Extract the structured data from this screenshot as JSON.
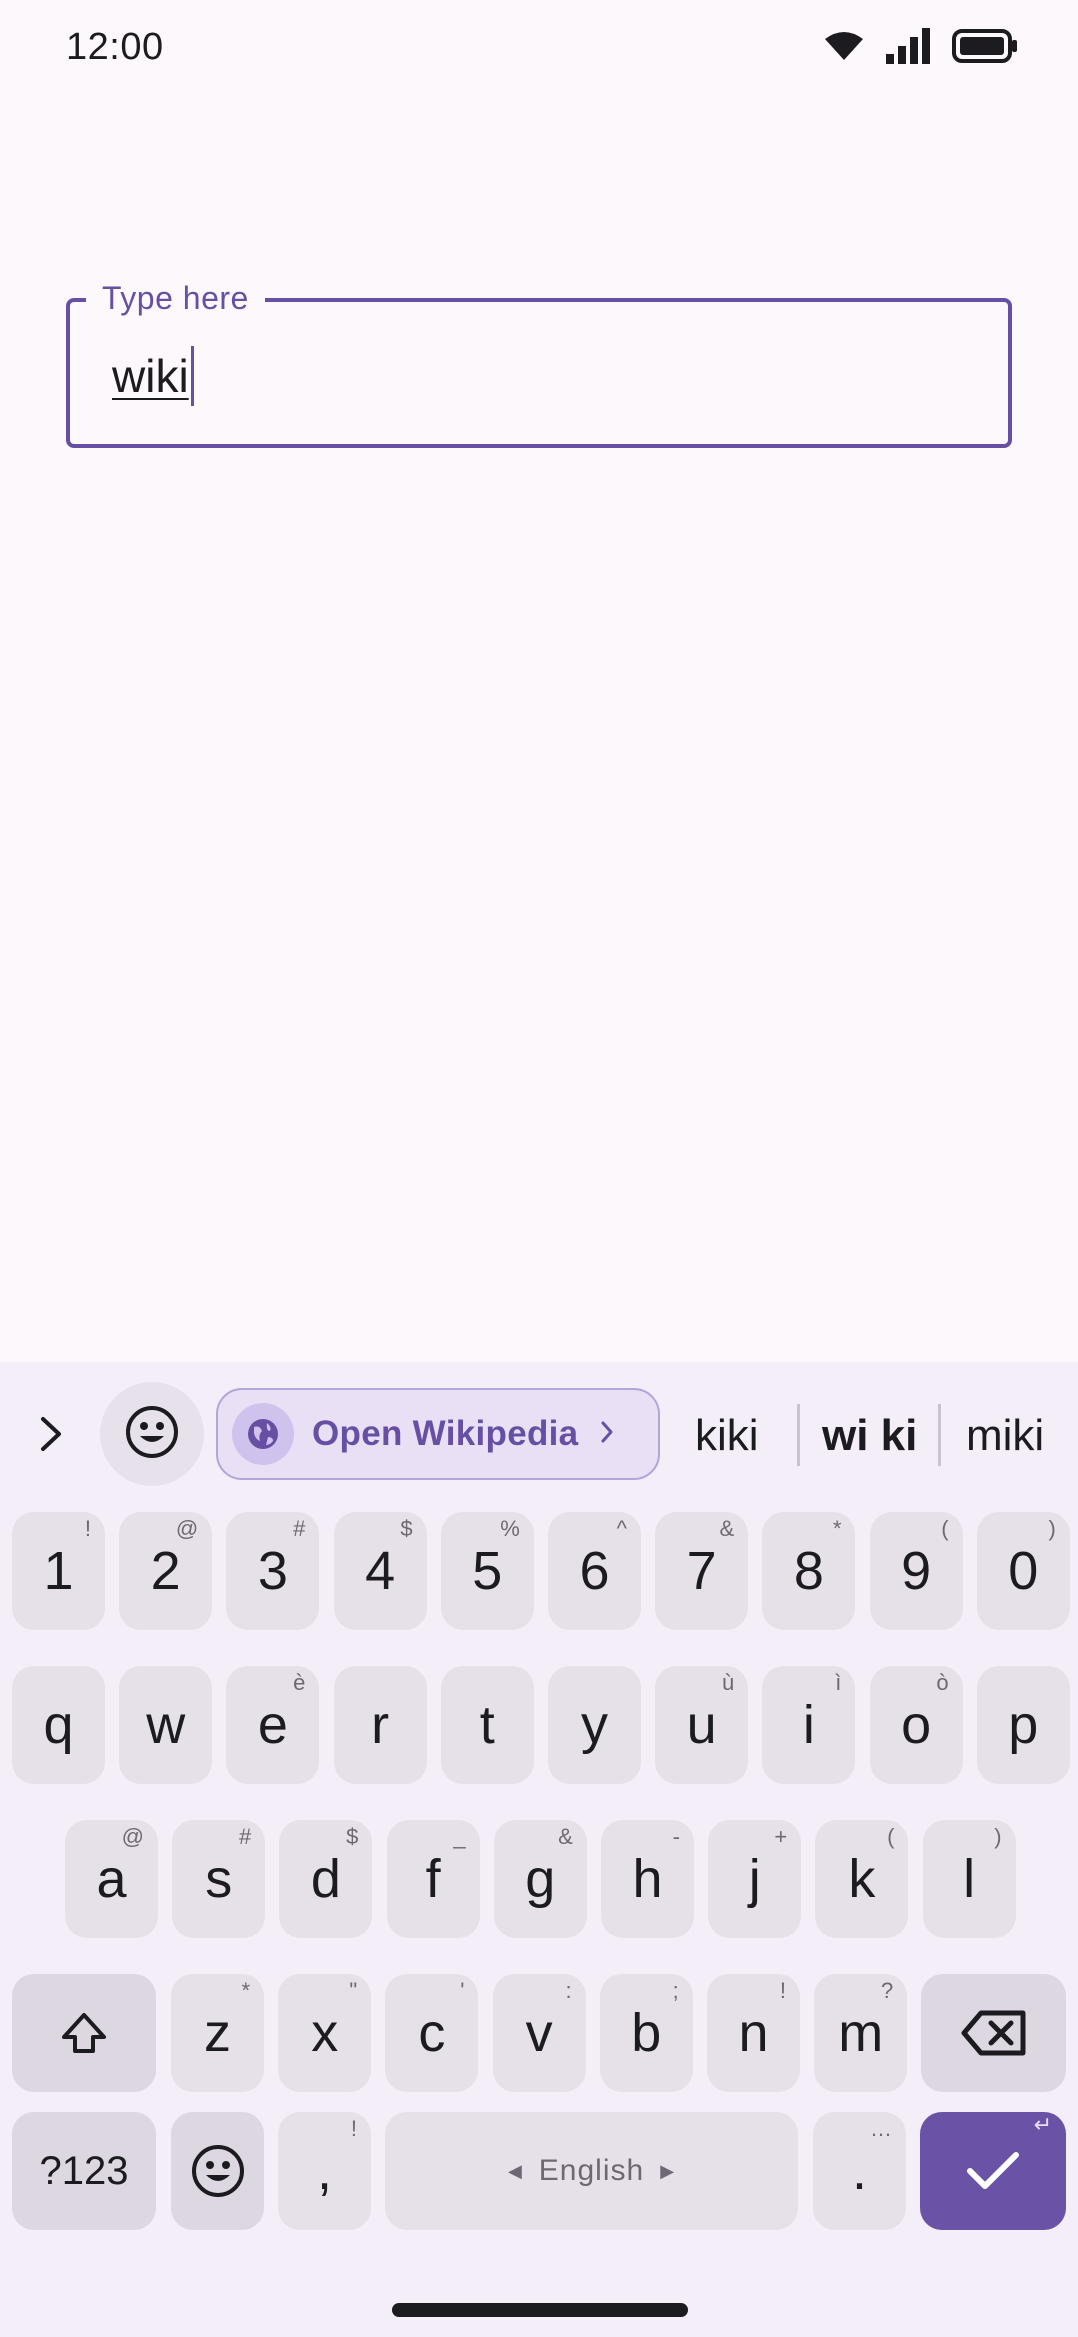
{
  "status_bar": {
    "time": "12:00",
    "icons": [
      "wifi-icon",
      "signal-icon",
      "battery-icon"
    ]
  },
  "text_field": {
    "label": "Type here",
    "value": "wiki"
  },
  "keyboard": {
    "suggestions": {
      "chip_label": "Open Wikipedia",
      "words": [
        "kiki",
        "wi ki",
        "miki"
      ]
    },
    "number_row": [
      {
        "main": "1",
        "hint": "!"
      },
      {
        "main": "2",
        "hint": "@"
      },
      {
        "main": "3",
        "hint": "#"
      },
      {
        "main": "4",
        "hint": "$"
      },
      {
        "main": "5",
        "hint": "%"
      },
      {
        "main": "6",
        "hint": "^"
      },
      {
        "main": "7",
        "hint": "&"
      },
      {
        "main": "8",
        "hint": "*"
      },
      {
        "main": "9",
        "hint": "("
      },
      {
        "main": "0",
        "hint": ")"
      }
    ],
    "row1": [
      {
        "main": "q",
        "hint": ""
      },
      {
        "main": "w",
        "hint": ""
      },
      {
        "main": "e",
        "hint": "è"
      },
      {
        "main": "r",
        "hint": ""
      },
      {
        "main": "t",
        "hint": ""
      },
      {
        "main": "y",
        "hint": ""
      },
      {
        "main": "u",
        "hint": "ù"
      },
      {
        "main": "i",
        "hint": "ì"
      },
      {
        "main": "o",
        "hint": "ò"
      },
      {
        "main": "p",
        "hint": ""
      }
    ],
    "row2": [
      {
        "main": "a",
        "hint": "@"
      },
      {
        "main": "s",
        "hint": "#"
      },
      {
        "main": "d",
        "hint": "$"
      },
      {
        "main": "f",
        "hint": "_"
      },
      {
        "main": "g",
        "hint": "&"
      },
      {
        "main": "h",
        "hint": "-"
      },
      {
        "main": "j",
        "hint": "+"
      },
      {
        "main": "k",
        "hint": "("
      },
      {
        "main": "l",
        "hint": ")"
      }
    ],
    "row3": [
      {
        "main": "z",
        "hint": "*"
      },
      {
        "main": "x",
        "hint": "\""
      },
      {
        "main": "c",
        "hint": "'"
      },
      {
        "main": "v",
        "hint": ":"
      },
      {
        "main": "b",
        "hint": ";"
      },
      {
        "main": "n",
        "hint": "!"
      },
      {
        "main": "m",
        "hint": "?"
      }
    ],
    "bottom_row": {
      "symbols_label": "?123",
      "comma": {
        "main": ",",
        "hint": "!"
      },
      "space_label": "English",
      "period": {
        "main": ".",
        "hint": "…"
      },
      "enter_hint": "↵"
    }
  },
  "colors": {
    "accent": "#6750a4",
    "background": "#fdf8fc",
    "keyboard_bg": "#f3eef7",
    "key_bg": "#e6e1e8",
    "enter_bg": "#6a52a6"
  }
}
